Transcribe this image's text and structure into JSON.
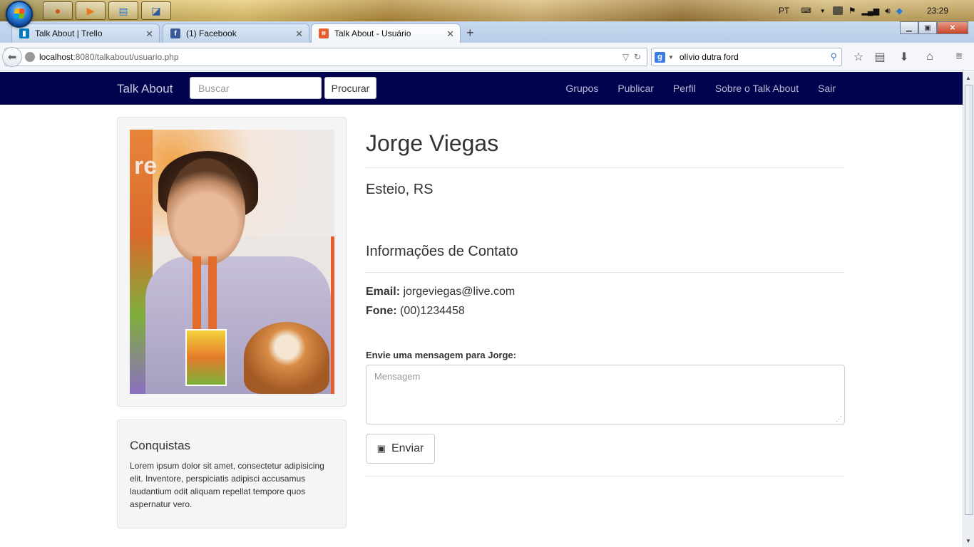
{
  "os": {
    "lang": "PT",
    "clock": "23:29"
  },
  "browser": {
    "tabs": [
      {
        "title": "Talk About | Trello"
      },
      {
        "title": "(1) Facebook"
      },
      {
        "title": "Talk About - Usuário"
      }
    ],
    "url_host": "localhost",
    "url_rest": ":8080/talkabout/usuario.php",
    "search_value": "olívio dutra ford"
  },
  "site": {
    "brand": "Talk About",
    "search_placeholder": "Buscar",
    "search_button": "Procurar",
    "nav_links": [
      "Grupos",
      "Publicar",
      "Perfil",
      "Sobre o Talk About",
      "Sair"
    ]
  },
  "profile": {
    "name": "Jorge Viegas",
    "location": "Esteio, RS",
    "contact_title": "Informações de Contato",
    "email_label": "Email:",
    "email": "jorgeviegas@live.com",
    "phone_label": "Fone:",
    "phone": "(00)1234458",
    "message_label": "Envie uma mensagem para Jorge:",
    "message_placeholder": "Mensagem",
    "send_button": "Enviar"
  },
  "achievements": {
    "title": "Conquistas",
    "text": "Lorem ipsum dolor sit amet, consectetur adipisicing elit. Inventore, perspiciatis adipisci accusamus laudantium odit aliquam repellat tempore quos aspernatur vero."
  },
  "colors": {
    "site_nav_bg": "#02034f"
  }
}
